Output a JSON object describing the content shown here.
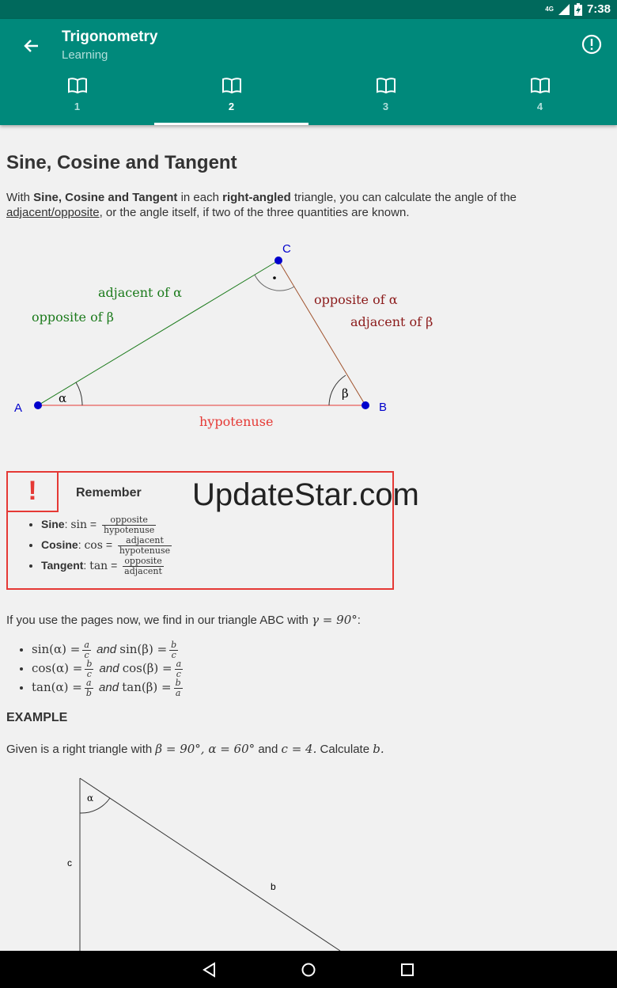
{
  "status": {
    "network": "4G",
    "time": "7:38"
  },
  "appbar": {
    "title": "Trigonometry",
    "subtitle": "Learning"
  },
  "tabs": [
    {
      "label": "1"
    },
    {
      "label": "2"
    },
    {
      "label": "3"
    },
    {
      "label": "4"
    }
  ],
  "content": {
    "heading": "Sine, Cosine and Tangent",
    "intro": {
      "p1": "With ",
      "b1": "Sine, Cosine and Tangent",
      "p2": " in each ",
      "b2": "right-angled",
      "p3": " triangle, you can calculate the angle of the",
      "link": "adjacent/opposite",
      "p4": ", or the angle itself, if two of the three quantities are known."
    },
    "diagram": {
      "A": "A",
      "B": "B",
      "C": "C",
      "adj_alpha": "adjacent of α",
      "opp_beta": "opposite of β",
      "opp_alpha": "opposite of α",
      "adj_beta": "adjacent of β",
      "hyp": "hypotenuse",
      "alpha": "α",
      "beta": "β"
    },
    "remember": {
      "title": "Remember",
      "items": [
        {
          "label": "Sine",
          "fn": "sin",
          "num": "opposite",
          "den": "hypotenuse"
        },
        {
          "label": "Cosine",
          "fn": "cos",
          "num": "adjacent",
          "den": "hypotenuse"
        },
        {
          "label": "Tangent",
          "fn": "tan",
          "num": "opposite",
          "den": "adjacent"
        }
      ]
    },
    "watermark": "UpdateStar.com",
    "pages_text": "If you use the pages now, we find in our triangle ABC with",
    "pages_math": "γ = 90°",
    "pages_colon": ":",
    "identities": [
      {
        "lhs1": "sin(α) =",
        "n1": "a",
        "d1": "c",
        "and": "and",
        "lhs2": "sin(β) =",
        "n2": "b",
        "d2": "c"
      },
      {
        "lhs1": "cos(α) =",
        "n1": "b",
        "d1": "c",
        "and": "and",
        "lhs2": "cos(β) =",
        "n2": "a",
        "d2": "c"
      },
      {
        "lhs1": "tan(α) =",
        "n1": "a",
        "d1": "b",
        "and": "and",
        "lhs2": "tan(β) =",
        "n2": "b",
        "d2": "a"
      }
    ],
    "example_title": "EXAMPLE",
    "given": {
      "t1": "Given is a right triangle with",
      "m1": "β = 90°, α = 60°",
      "t2": "and",
      "m2": "c = 4.",
      "t3": "Calculate",
      "m3": "b."
    },
    "diagram2": {
      "alpha": "α",
      "c": "c",
      "b": "b"
    }
  }
}
